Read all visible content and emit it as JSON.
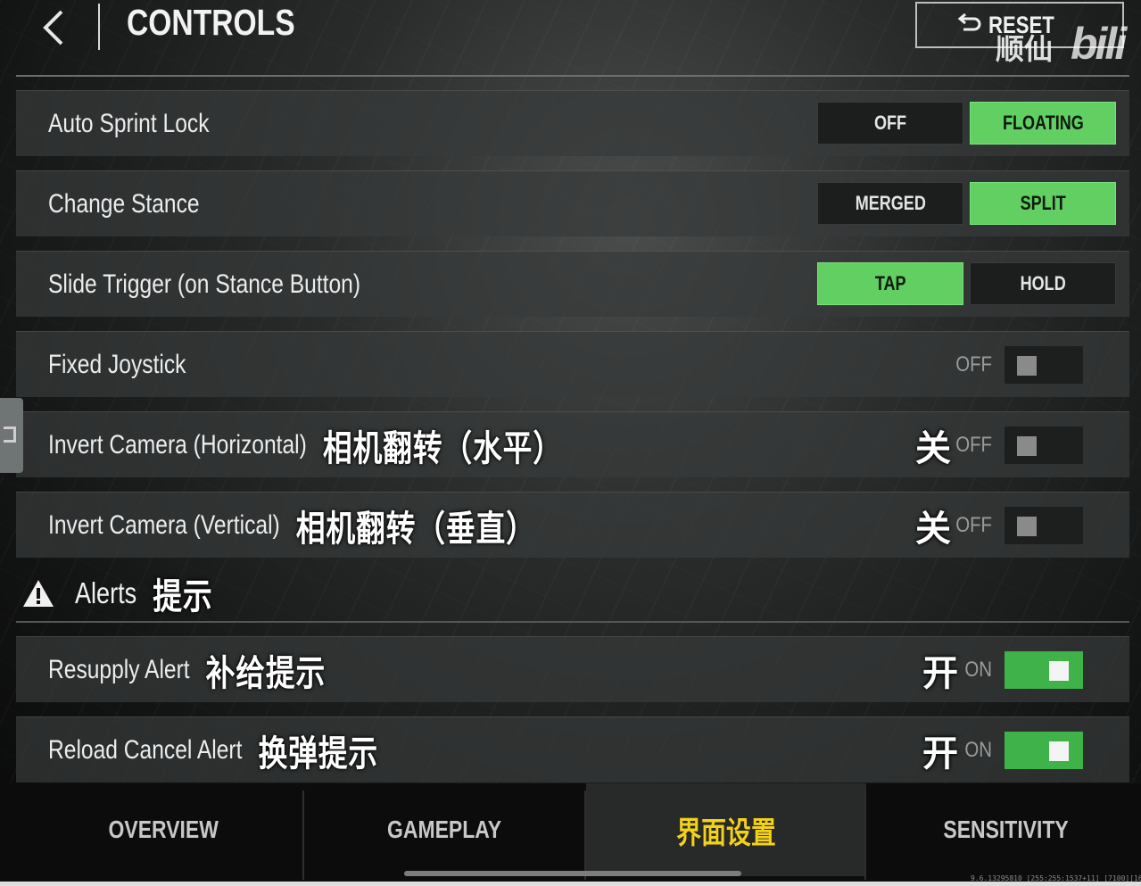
{
  "header": {
    "title": "CONTROLS",
    "reset_label": "RESET",
    "watermark_cn": "顺仙",
    "watermark_logo": "bili"
  },
  "rows": [
    {
      "label": "Auto Sprint Lock",
      "type": "segmented",
      "options": [
        "OFF",
        "FLOATING"
      ],
      "selected": "FLOATING"
    },
    {
      "label": "Change Stance",
      "type": "segmented",
      "options": [
        "MERGED",
        "SPLIT"
      ],
      "selected": "SPLIT"
    },
    {
      "label": "Slide Trigger (on Stance Button)",
      "type": "segmented",
      "options": [
        "TAP",
        "HOLD"
      ],
      "selected": "TAP"
    },
    {
      "label": "Fixed Joystick",
      "type": "toggle",
      "state_text": "OFF",
      "on": false
    },
    {
      "label": "Invert Camera (Horizontal)",
      "cn_note": "相机翻转（水平）",
      "cn_state": "关",
      "type": "toggle",
      "state_text": "OFF",
      "on": false
    },
    {
      "label": "Invert Camera (Vertical)",
      "cn_note": "相机翻转（垂直）",
      "cn_state": "关",
      "type": "toggle",
      "state_text": "OFF",
      "on": false
    }
  ],
  "alerts": {
    "title": "Alerts",
    "cn_note": "提示",
    "rows": [
      {
        "label": "Resupply Alert",
        "cn_note": "补给提示",
        "cn_state": "开",
        "type": "toggle",
        "state_text": "ON",
        "on": true
      },
      {
        "label": "Reload Cancel Alert",
        "cn_note": "换弹提示",
        "cn_state": "开",
        "type": "toggle",
        "state_text": "ON",
        "on": true
      }
    ]
  },
  "nav": {
    "tabs": [
      "OVERVIEW",
      "GAMEPLAY",
      "界面设置",
      "SENSITIVITY"
    ],
    "active_index": 2
  },
  "footer": {
    "version": "9.6.13295810 [255:255:1537+11] [7100][16"
  },
  "colors": {
    "accent_green": "#62cf62",
    "toggle_green": "#3fb34a",
    "active_tab": "#f3d21a"
  }
}
